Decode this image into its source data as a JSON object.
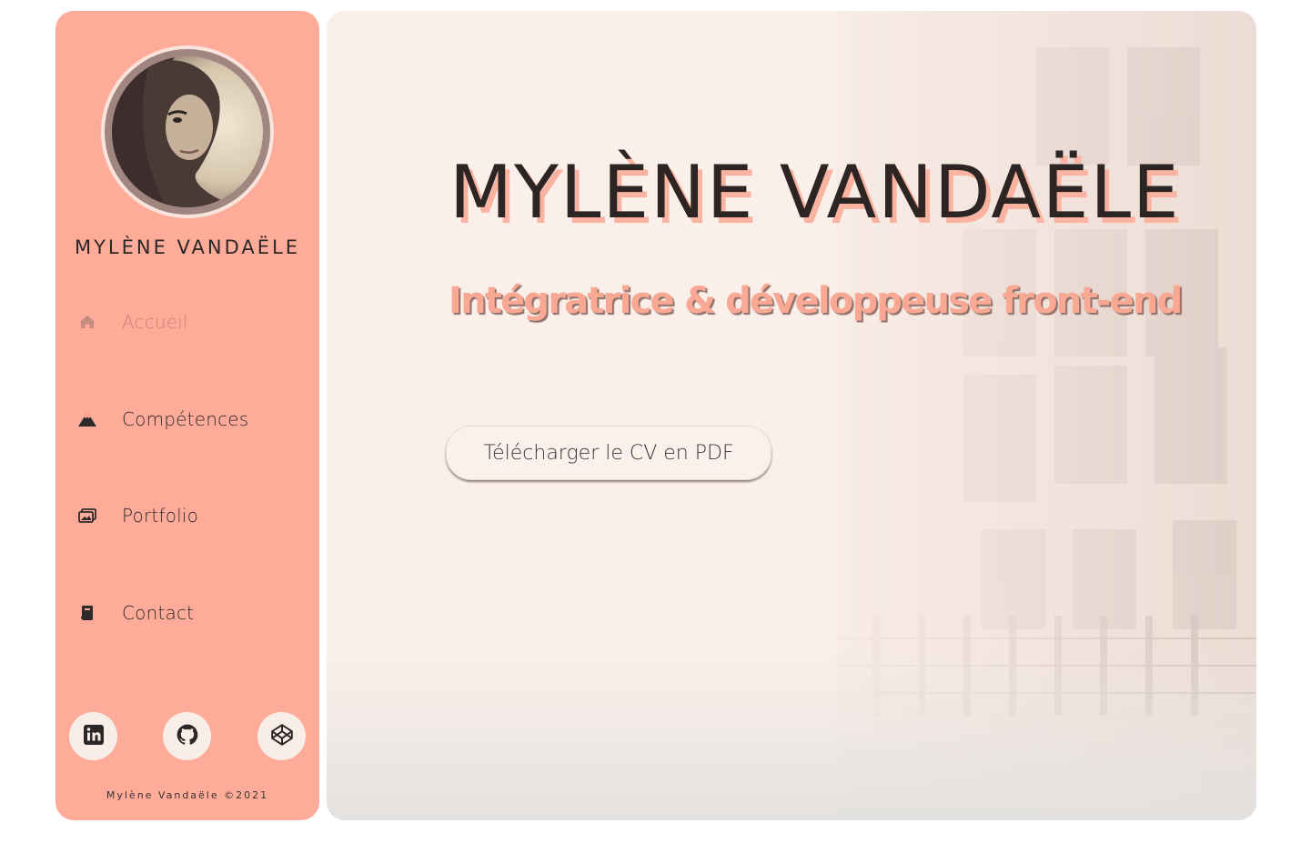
{
  "sidebar": {
    "name": "MYLÈNE VANDAËLE",
    "nav": [
      {
        "label": "Accueil",
        "icon": "home-icon",
        "active": true
      },
      {
        "label": "Compétences",
        "icon": "mountain-icon",
        "active": false
      },
      {
        "label": "Portfolio",
        "icon": "images-icon",
        "active": false
      },
      {
        "label": "Contact",
        "icon": "address-book-icon",
        "active": false
      }
    ],
    "social": [
      {
        "icon": "linkedin-icon"
      },
      {
        "icon": "github-icon"
      },
      {
        "icon": "codepen-icon"
      }
    ],
    "footer": "Mylène Vandaële ©2021"
  },
  "hero": {
    "title": "MYLÈNE VANDAËLE",
    "subtitle": "Intégratrice & développeuse front-end",
    "cv_button": "Télécharger le CV en PDF"
  },
  "colors": {
    "sidebar_bg": "#ffab99",
    "main_bg": "#faefe9",
    "accent": "#f9a893",
    "text_dark": "#2d2524",
    "social_bg": "#f9ede7"
  }
}
